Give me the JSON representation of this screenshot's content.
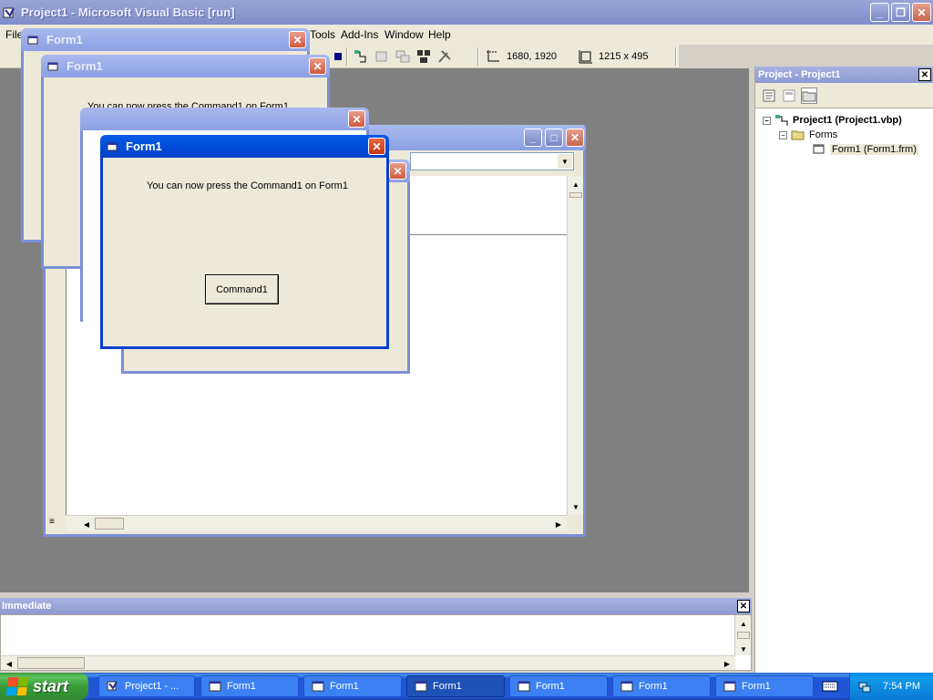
{
  "app": {
    "title": "Project1 - Microsoft Visual Basic [run]"
  },
  "menu": {
    "items": [
      "File",
      "Tools",
      "Add-Ins",
      "Window",
      "Help"
    ]
  },
  "toolbar": {
    "position": "1680, 1920",
    "size": "1215 x 495"
  },
  "forms": {
    "title": "Form1",
    "message": "You can now press the Command1 on Form1",
    "command_label": "Command1"
  },
  "project": {
    "title": "Project - Project1",
    "root": "Project1 (Project1.vbp)",
    "folder": "Forms",
    "form_item": "Form1 (Form1.frm)"
  },
  "immediate": {
    "title": "Immediate"
  },
  "taskbar": {
    "start_label": "start",
    "tasks": [
      "Project1 - ...",
      "Form1",
      "Form1",
      "Form1",
      "Form1",
      "Form1",
      "Form1"
    ],
    "pressed_index": 3,
    "clock": "7:54 PM"
  },
  "colors": {
    "active_title": "#0053e0",
    "inactive_title": "#8ba0e4",
    "taskbar": "#2157d7",
    "start_green": "#3a9b3a",
    "mdi_bg": "#808080"
  },
  "icons": {
    "app": "vb-project-icon",
    "form": "form-icon",
    "close": "close-icon",
    "minimize": "minimize-icon",
    "maximize": "maximize-icon",
    "restore": "restore-icon",
    "folder": "folder-icon",
    "clock_tray": "network-icon"
  }
}
